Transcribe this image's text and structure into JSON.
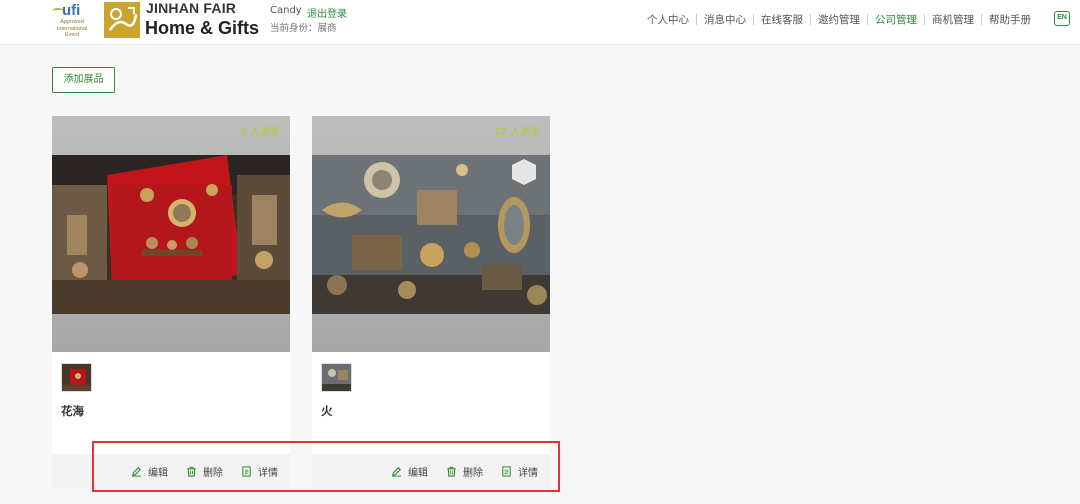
{
  "header": {
    "ufi_logo": {
      "wordmark": "ufi",
      "sub": [
        "Approved",
        "International",
        "Event"
      ]
    },
    "brand_line1": "JINHAN FAIR",
    "brand_line2": "Home & Gifts",
    "user_name": "Candy",
    "logout": "退出登录",
    "role": "当前身份：展商",
    "nav": [
      {
        "label": "个人中心",
        "active": false
      },
      {
        "label": "消息中心",
        "active": false
      },
      {
        "label": "在线客服",
        "active": false
      },
      {
        "label": "邀约管理",
        "active": false
      },
      {
        "label": "公司管理",
        "active": true
      },
      {
        "label": "商机管理",
        "active": false
      },
      {
        "label": "帮助手册",
        "active": false
      }
    ],
    "lang_button": "EN"
  },
  "toolbar": {
    "add_label": "添加展品"
  },
  "products": [
    {
      "views": "0 人浏览",
      "name": "花海",
      "actions": {
        "edit": "编辑",
        "delete": "删除",
        "detail": "详情"
      },
      "icons": {
        "edit": "pencil-icon",
        "delete": "trash-icon",
        "detail": "document-icon"
      }
    },
    {
      "views": "12 人浏览",
      "name": "火",
      "actions": {
        "edit": "编辑",
        "delete": "删除",
        "detail": "详情"
      },
      "icons": {
        "edit": "pencil-icon",
        "delete": "trash-icon",
        "detail": "document-icon"
      }
    }
  ],
  "colors": {
    "accent": "#2f8a3c",
    "views": "#a6d41e",
    "highlight": "#e0343a"
  }
}
